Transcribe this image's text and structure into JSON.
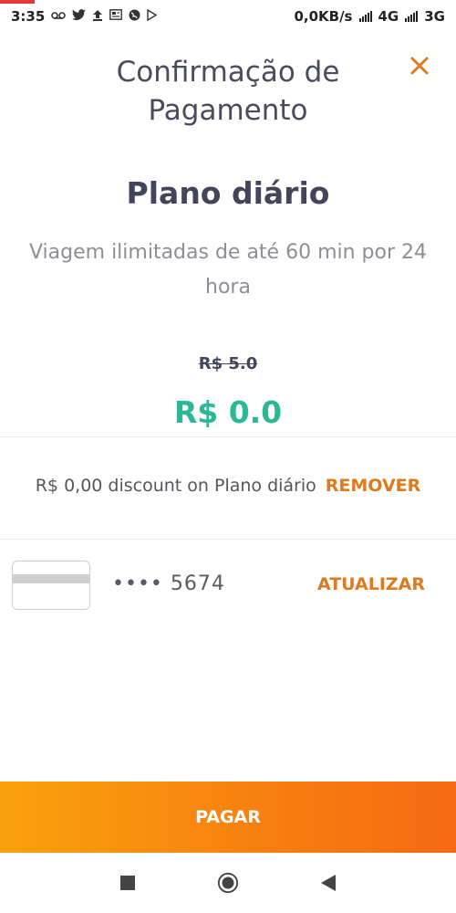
{
  "status_bar": {
    "time": "3:35",
    "network_speed": "0,0KB/s",
    "network_1": "4G",
    "network_2": "3G",
    "left_icons": [
      "voicemail-icon",
      "twitter-icon",
      "upload-icon",
      "news-icon",
      "globe-icon",
      "play-store-icon"
    ]
  },
  "header": {
    "title_line1": "Confirmação de",
    "title_line2": "Pagamento",
    "close_icon": "close-icon"
  },
  "plan": {
    "name": "Plano diário",
    "description": "Viagem ilimitadas de até 60 min por 24 hora",
    "original_price": "R$ 5.0",
    "final_price": "R$ 0.0"
  },
  "discount": {
    "text": "R$ 0,00 discount on Plano diário",
    "remove_label": "REMOVER"
  },
  "payment_method": {
    "card_icon": "credit-card-icon",
    "masked_number": "•••• 5674",
    "update_label": "ATUALIZAR"
  },
  "actions": {
    "pay_label": "PAGAR"
  },
  "nav_bar": {
    "icons": [
      "recents-square-icon",
      "home-circle-icon",
      "back-triangle-icon"
    ]
  },
  "colors": {
    "accent_orange": "#e07a1e",
    "price_green": "#2ab896",
    "pay_gradient_start": "#f9a20c",
    "pay_gradient_end": "#f56a12",
    "title_text": "#44445a"
  }
}
